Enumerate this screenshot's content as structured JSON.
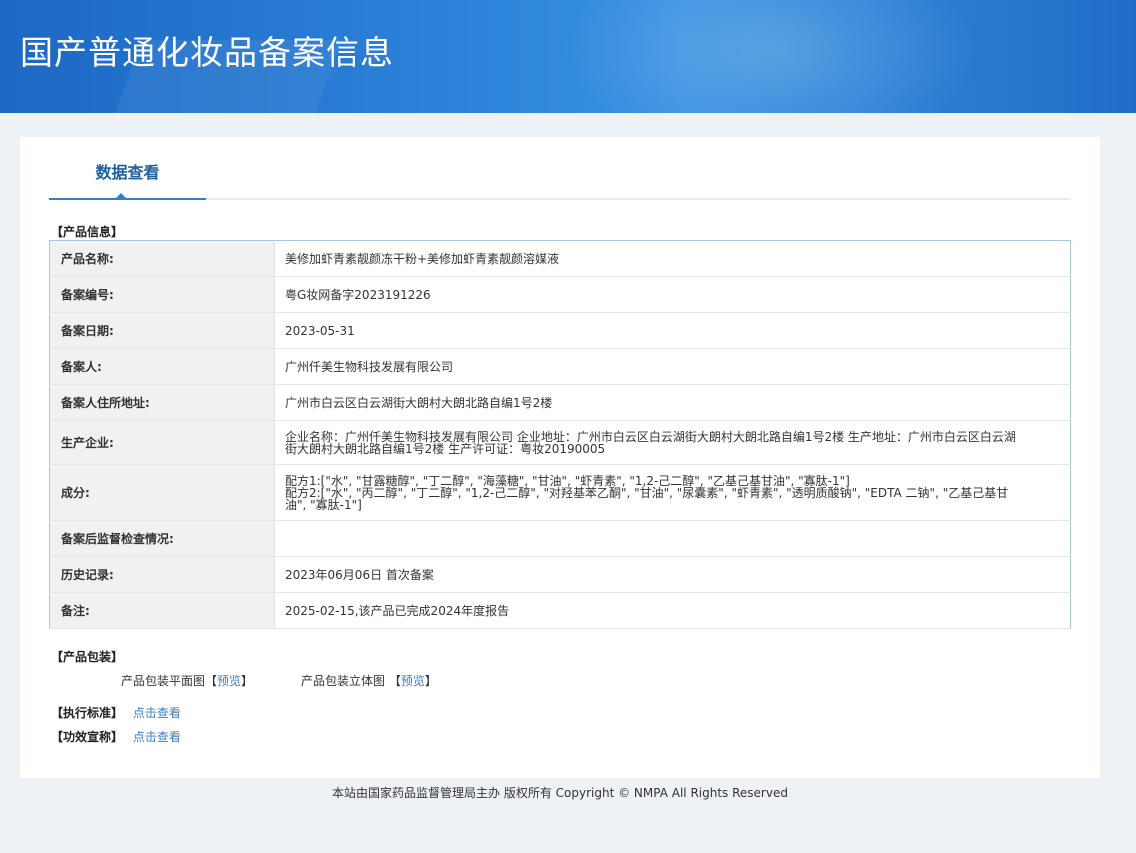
{
  "header": {
    "title": "国产普通化妆品备案信息"
  },
  "tabs": [
    {
      "label": "数据查看",
      "active": true
    }
  ],
  "product_info": {
    "section_label": "【产品信息】",
    "rows": [
      {
        "label": "产品名称:",
        "value": "美修加虾青素靓颜冻干粉+美修加虾青素靓颜溶媒液"
      },
      {
        "label": "备案编号:",
        "value": "粤G妆网备字2023191226"
      },
      {
        "label": "备案日期:",
        "value": "2023-05-31"
      },
      {
        "label": "备案人:",
        "value": "广州仟美生物科技发展有限公司"
      },
      {
        "label": "备案人住所地址:",
        "value": "广州市白云区白云湖街大朗村大朗北路自编1号2楼"
      },
      {
        "label": "生产企业:",
        "value": "企业名称：广州仟美生物科技发展有限公司 企业地址：广州市白云区白云湖街大朗村大朗北路自编1号2楼 生产地址：广州市白云区白云湖街大朗村大朗北路自编1号2楼 生产许可证：粤妆20190005"
      },
      {
        "label": "成分:",
        "value": "配方1:[\"水\", \"甘露糖醇\", \"丁二醇\", \"海藻糖\", \"甘油\", \"虾青素\", \"1,2-己二醇\", \"乙基己基甘油\", \"寡肽-1\"]",
        "value2": "配方2:[\"水\", \"丙二醇\", \"丁二醇\", \"1,2-己二醇\", \"对羟基苯乙酮\", \"甘油\", \"尿囊素\", \"虾青素\", \"透明质酸钠\", \"EDTA 二钠\", \"乙基己基甘油\", \"寡肽-1\"]"
      },
      {
        "label": "备案后监督检查情况:",
        "value": ""
      },
      {
        "label": "历史记录:",
        "value": "2023年06月06日 首次备案"
      },
      {
        "label": "备注:",
        "value": "2025-02-15,该产品已完成2024年度报告"
      }
    ]
  },
  "packaging": {
    "section_label": "【产品包装】",
    "items": [
      {
        "label": "产品包装平面图",
        "open": "【",
        "link": "预览",
        "close": "】"
      },
      {
        "label": "产品包装立体图",
        "open": "【",
        "link": "预览",
        "close": "】"
      }
    ]
  },
  "standard": {
    "label": "【执行标准】",
    "link": "点击查看"
  },
  "efficacy": {
    "label": "【功效宣称】",
    "link": "点击查看"
  },
  "footer": {
    "text": "本站由国家药品监督管理局主办 版权所有 Copyright © NMPA All Rights Reserved"
  }
}
